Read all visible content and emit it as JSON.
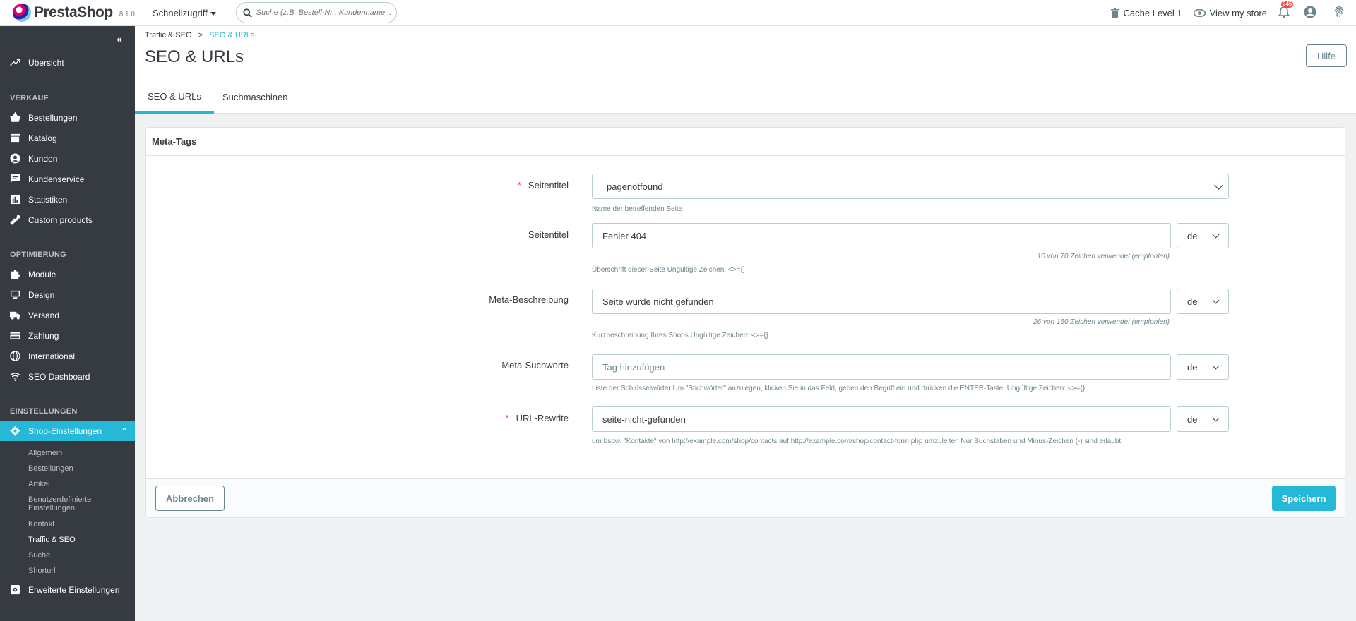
{
  "app": {
    "brand": "PrestaShop",
    "version": "8.1.0",
    "quick_access": "Schnellzugriff",
    "search_placeholder": "Suche (z.B. Bestell-Nr., Kundenname ...",
    "cache": "Cache Level 1",
    "view_store": "View my store",
    "notifications": "245"
  },
  "sidebar": {
    "overview": "Übersicht",
    "section_sales": "VERKAUF",
    "sales_items": [
      "Bestellungen",
      "Katalog",
      "Kunden",
      "Kundenservice",
      "Statistiken",
      "Custom products"
    ],
    "section_optimization": "OPTIMIERUNG",
    "optimization_items": [
      "Module",
      "Design",
      "Versand",
      "Zahlung",
      "International",
      "SEO Dashboard"
    ],
    "section_settings": "EINSTELLUNGEN",
    "shop_settings": "Shop-Einstellungen",
    "sub_items": [
      "Allgemein",
      "Bestellungen",
      "Artikel",
      "Benutzerdefinierte Einstellungen",
      "Kontakt",
      "Traffic & SEO",
      "Suche",
      "Shorturl"
    ],
    "advanced": "Erweiterte Einstellungen"
  },
  "header": {
    "breadcrumb_parent": "Traffic & SEO",
    "breadcrumb_separator": ">",
    "breadcrumb_current": "SEO & URLs",
    "title": "SEO & URLs",
    "help_button": "Hilfe"
  },
  "tabs": [
    "SEO & URLs",
    "Suchmaschinen"
  ],
  "panel": {
    "title": "Meta-Tags",
    "page_name_label": "Seitentitel",
    "page_name_value": "pagenotfound",
    "page_name_help": "Name der betreffenden Seite",
    "title_label": "Seitentitel",
    "title_value": "Fehler 404",
    "title_counter": "10 von 70 Zeichen verwendet (empfohlen)",
    "title_help": "Überschrift dieser Seite Ungültige Zeichen: <>={}",
    "desc_label": "Meta-Beschreibung",
    "desc_value": "Seite wurde nicht gefunden",
    "desc_counter": "26 von 160 Zeichen verwendet (empfohlen)",
    "desc_help": "Kurzbeschreibung Ihres Shops Ungültige Zeichen: <>={}",
    "keywords_label": "Meta-Suchworte",
    "keywords_placeholder": "Tag hinzufügen",
    "keywords_help": "Liste der Schlüsselwörter Um \"Stichwörter\" anzulegen, klicken Sie in das Feld, geben den Begriff ein und drücken die ENTER-Taste. Ungültige Zeichen: <>={}",
    "rewrite_label": "URL-Rewrite",
    "rewrite_value": "seite-nicht-gefunden",
    "rewrite_help": "um bspw. \"Kontakte\" von http://example.com/shop/contacts auf http://example.com/shop/contact-form.php umzuleiten Nur Buchstaben und Minus-Zeichen (-) sind erlaubt.",
    "required_mark": "*",
    "lang": "de",
    "cancel": "Abbrechen",
    "save": "Speichern"
  },
  "colors": {
    "accent": "#25b9d7",
    "sidebar": "#363a41",
    "required": "#f54c3e"
  }
}
